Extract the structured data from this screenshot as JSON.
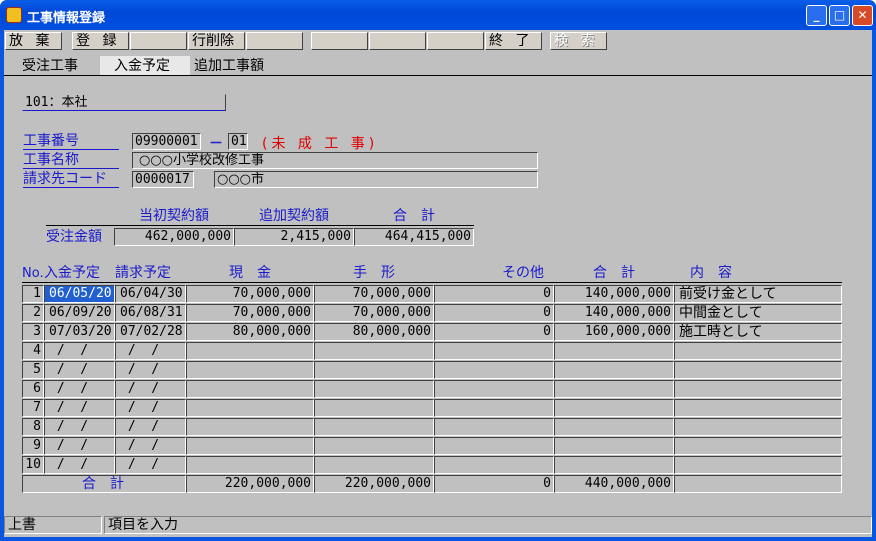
{
  "window": {
    "title": "工事情報登録"
  },
  "toolbar": [
    "放 棄",
    "登 録",
    "",
    "行削除",
    "",
    "",
    "",
    "",
    "終 了",
    "検 索"
  ],
  "tabs": [
    "受注工事",
    "入金予定",
    "追加工事額"
  ],
  "branch": "101：本社",
  "labels": {
    "job_no": "工事番号",
    "job_name": "工事名称",
    "bill_code": "請求先コード"
  },
  "job_no": "09900001",
  "job_sub": "01",
  "dash": "－",
  "job_status": "(未 成 工 事)",
  "job_name": "○○○小学校改修工事",
  "bill_code": "0000017",
  "bill_name": "○○○市",
  "summary": {
    "headers": [
      "当初契約額",
      "追加契約額",
      "合　計"
    ],
    "row_label": "受注金額",
    "values": [
      "462,000,000",
      "2,415,000",
      "464,415,000"
    ]
  },
  "grid": {
    "headers": [
      "No.",
      "入金予定",
      "請求予定",
      "現　金",
      "手　形",
      "その他",
      "合　計",
      "内　容"
    ],
    "rows": [
      [
        "1",
        "06/05/20",
        "06/04/30",
        "70,000,000",
        "70,000,000",
        "0",
        "140,000,000",
        "前受け金として"
      ],
      [
        "2",
        "06/09/20",
        "06/08/31",
        "70,000,000",
        "70,000,000",
        "0",
        "140,000,000",
        "中間金として"
      ],
      [
        "3",
        "07/03/20",
        "07/02/28",
        "80,000,000",
        "80,000,000",
        "0",
        "160,000,000",
        "施工時として"
      ],
      [
        "4",
        " /  /",
        " /  /",
        "",
        "",
        "",
        "",
        ""
      ],
      [
        "5",
        " /  /",
        " /  /",
        "",
        "",
        "",
        "",
        ""
      ],
      [
        "6",
        " /  /",
        " /  /",
        "",
        "",
        "",
        "",
        ""
      ],
      [
        "7",
        " /  /",
        " /  /",
        "",
        "",
        "",
        "",
        ""
      ],
      [
        "8",
        " /  /",
        " /  /",
        "",
        "",
        "",
        "",
        ""
      ],
      [
        "9",
        " /  /",
        " /  /",
        "",
        "",
        "",
        "",
        ""
      ],
      [
        "10",
        " /  /",
        " /  /",
        "",
        "",
        "",
        "",
        ""
      ]
    ],
    "total_label": "合　計",
    "totals": [
      "220,000,000",
      "220,000,000",
      "0",
      "440,000,000"
    ]
  },
  "status": {
    "mode": "上書",
    "message": "項目を入力"
  }
}
